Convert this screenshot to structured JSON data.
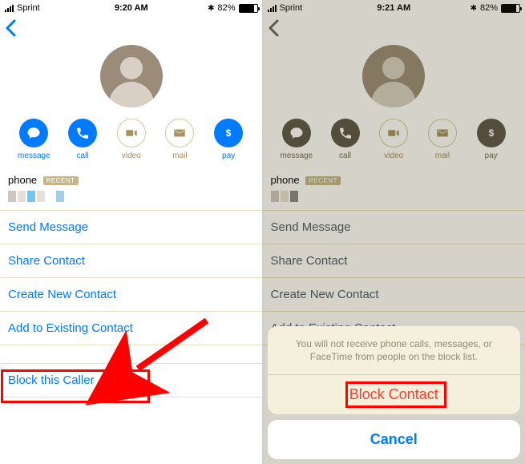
{
  "left": {
    "status": {
      "carrier": "Sprint",
      "time": "9:20 AM",
      "battery_pct": "82%",
      "battery_fill": 82
    },
    "actions": {
      "message": "message",
      "call": "call",
      "video": "video",
      "mail": "mail",
      "pay": "pay"
    },
    "phone_section": {
      "label": "phone",
      "recent_badge": "RECENT"
    },
    "rows": {
      "send_message": "Send Message",
      "share_contact": "Share Contact",
      "create_new": "Create New Contact",
      "add_existing": "Add to Existing Contact",
      "block": "Block this Caller"
    }
  },
  "right": {
    "status": {
      "carrier": "Sprint",
      "time": "9:21 AM",
      "battery_pct": "82%",
      "battery_fill": 82
    },
    "actions": {
      "message": "message",
      "call": "call",
      "video": "video",
      "mail": "mail",
      "pay": "pay"
    },
    "phone_section": {
      "label": "phone",
      "recent_badge": "RECENT"
    },
    "rows": {
      "send_message": "Send Message",
      "share_contact": "Share Contact",
      "create_new": "Create New Contact",
      "add_existing": "Add to Existing Contact"
    },
    "sheet": {
      "message": "You will not receive phone calls, messages, or FaceTime from people on the block list.",
      "block": "Block Contact",
      "cancel": "Cancel"
    }
  }
}
